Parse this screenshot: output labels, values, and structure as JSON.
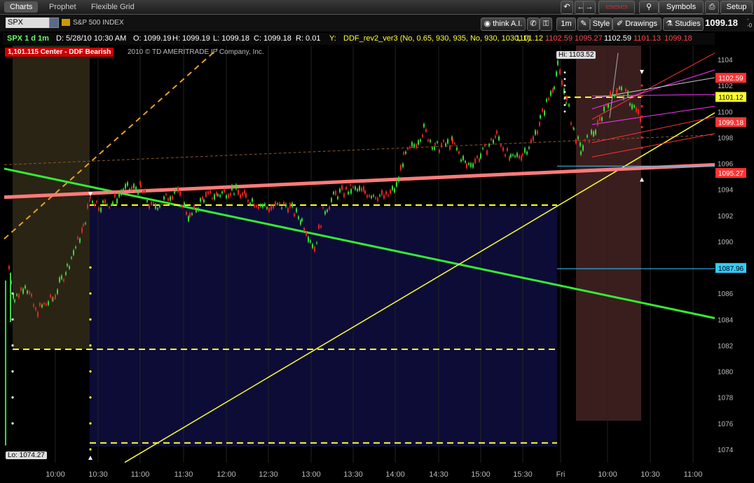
{
  "app": {
    "tabs": [
      "Charts",
      "Prophet",
      "Flexible Grid"
    ],
    "buttons": {
      "think": "think A.I.",
      "symbols": "Symbols",
      "setup": "Setup",
      "style": "Style",
      "drawings": "Drawings",
      "studies": "Studies",
      "interval": "1m"
    }
  },
  "symbol": {
    "ticker": "SPX",
    "index_name": "S&P 500 INDEX",
    "last": "1099.18",
    "change": [
      "-",
      "-0"
    ]
  },
  "infobar": {
    "desc": "SPX 1 d 1m",
    "date": "D: 5/28/10 10:30 AM",
    "open": "O: 1099.19",
    "high": "H: 1099.19",
    "low": "L: 1099.18",
    "close": "C: 1099.18",
    "range": "R: 0.01",
    "y": "Y:",
    "study": "DDF_rev2_ver3 (No, 0.65, 930, 935, No, 930, 1030, 1)",
    "study_values": [
      "1101.12",
      "1102.59",
      "1095.27",
      "1102.59",
      "1101.13",
      "1099.18"
    ]
  },
  "overlay": {
    "ddf_label": "1,101.115 Center - DDF Bearish",
    "copyright": "2010 © TD AMERITRADE IP Company, Inc.",
    "hi_label": "Hi: 1103.52",
    "lo_label": "Lo: 1074.27"
  },
  "chart_data": {
    "type": "line",
    "yaxis": {
      "ylim": [
        1073,
        1105
      ],
      "ticks": [
        1074,
        1076,
        1078,
        1080,
        1082,
        1084,
        1086,
        1088,
        1090,
        1092,
        1094,
        1096,
        1098,
        1100,
        1102,
        1104
      ]
    },
    "xaxis": {
      "tick_labels": [
        "10:00",
        "10:30",
        "11:00",
        "11:30",
        "12:00",
        "12:30",
        "13:00",
        "13:30",
        "14:00",
        "14:30",
        "15:00",
        "15:30",
        "Fri",
        "10:00",
        "10:30",
        "11:00"
      ]
    },
    "price_tags": [
      {
        "value": "1102.59",
        "color": "#ff3333"
      },
      {
        "value": "1101.12",
        "color": "#ffff33"
      },
      {
        "value": "1099.18",
        "color": "#ff3333"
      },
      {
        "value": "1095.27",
        "color": "#ff3333"
      },
      {
        "value": "1087.96",
        "color": "#33ccff"
      }
    ]
  }
}
